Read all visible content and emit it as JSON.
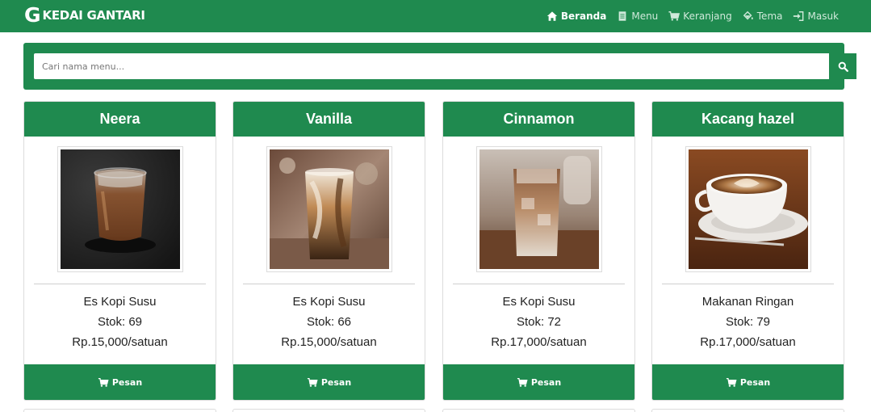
{
  "brand": {
    "logo_letter": "G",
    "name": "KEDAI GANTARI"
  },
  "nav": {
    "items": [
      {
        "label": "Beranda",
        "icon": "home-icon",
        "active": true
      },
      {
        "label": "Menu",
        "icon": "document-icon",
        "active": false
      },
      {
        "label": "Keranjang",
        "icon": "cart-icon",
        "active": false
      },
      {
        "label": "Tema",
        "icon": "paint-bucket-icon",
        "active": false
      },
      {
        "label": "Masuk",
        "icon": "sign-in-icon",
        "active": false
      }
    ]
  },
  "search": {
    "placeholder": "Cari nama menu...",
    "value": "",
    "button_icon": "search-icon"
  },
  "products": [
    {
      "name": "Neera",
      "category": "Es Kopi Susu",
      "stock_text": "Stok: 69",
      "price_text": "Rp.15,000/satuan",
      "button_label": "Pesan"
    },
    {
      "name": "Vanilla",
      "category": "Es Kopi Susu",
      "stock_text": "Stok: 66",
      "price_text": "Rp.15,000/satuan",
      "button_label": "Pesan"
    },
    {
      "name": "Cinnamon",
      "category": "Es Kopi Susu",
      "stock_text": "Stok: 72",
      "price_text": "Rp.17,000/satuan",
      "button_label": "Pesan"
    },
    {
      "name": "Kacang hazel",
      "category": "Makanan Ringan",
      "stock_text": "Stok: 79",
      "price_text": "Rp.17,000/satuan",
      "button_label": "Pesan"
    }
  ],
  "colors": {
    "primary": "#1f8a4f",
    "background": "#ffffff"
  }
}
